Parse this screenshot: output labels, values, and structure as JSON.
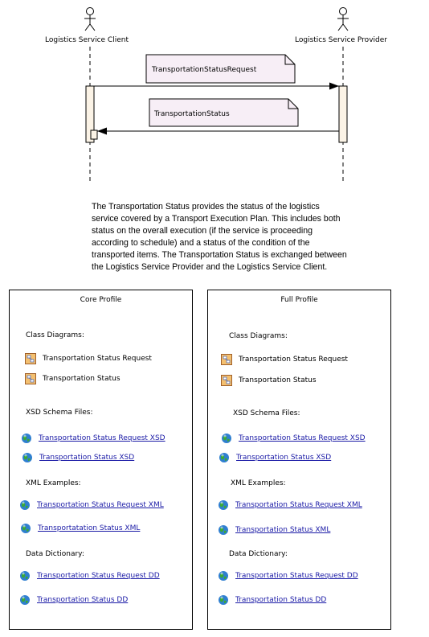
{
  "diagram": {
    "client_label": "Logistics Service Client",
    "provider_label": "Logistics Service Provider",
    "msg1": "TransportationStatusRequest",
    "msg2": "TransportationStatus"
  },
  "description": "The Transportation Status provides the status of the logistics service covered by a Transport Execution Plan. This includes both status on the overall execution (if the service is proceeding according to schedule) and a status of the condition of the transported items. The Transportation Status is exchanged between the Logistics Service Provider and the Logistics Service Client.",
  "core": {
    "title": "Core Profile",
    "class_heading": "Class Diagrams:",
    "class_1": "Transportation Status Request",
    "class_2": "Transportation Status",
    "xsd_heading": "XSD Schema Files:",
    "xsd_1": "Transportation Status Request XSD",
    "xsd_2": "Transportation Status XSD",
    "xml_heading": "XML Examples:",
    "xml_1": "Transportation Status Request XML",
    "xml_2": "Transportatation Status XML",
    "dd_heading": "Data Dictionary:",
    "dd_1": "Transportation Status Request DD",
    "dd_2": "Transportation Status DD"
  },
  "full": {
    "title": "Full Profile",
    "class_heading": "Class Diagrams:",
    "class_1": "Transportation Status Request",
    "class_2": "Transportation Status",
    "xsd_heading": "XSD Schema Files:",
    "xsd_1": "Transportation Status Request XSD",
    "xsd_2": "Transportation Status XSD",
    "xml_heading": "XML Examples:",
    "xml_1": "Transportation Status Request XML",
    "xml_2": "Transportation Status XML",
    "dd_heading": "Data Dictionary:",
    "dd_1": "Transportation Status Request DD",
    "dd_2": "Transportation Status DD"
  }
}
